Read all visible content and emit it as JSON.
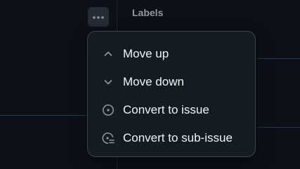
{
  "sidebar": {
    "labels_heading": "Labels"
  },
  "menu": {
    "items": [
      {
        "icon": "chevron-up-icon",
        "label": "Move up"
      },
      {
        "icon": "chevron-down-icon",
        "label": "Move down"
      },
      {
        "icon": "issue-opened-icon",
        "label": "Convert to issue"
      },
      {
        "icon": "sub-issue-icon",
        "label": "Convert to sub-issue"
      }
    ]
  },
  "colors": {
    "background": "#0d1117",
    "menu_background": "#151b23",
    "menu_border": "#3d444d",
    "text": "#f0f6fc",
    "muted_text": "#9198a1"
  }
}
